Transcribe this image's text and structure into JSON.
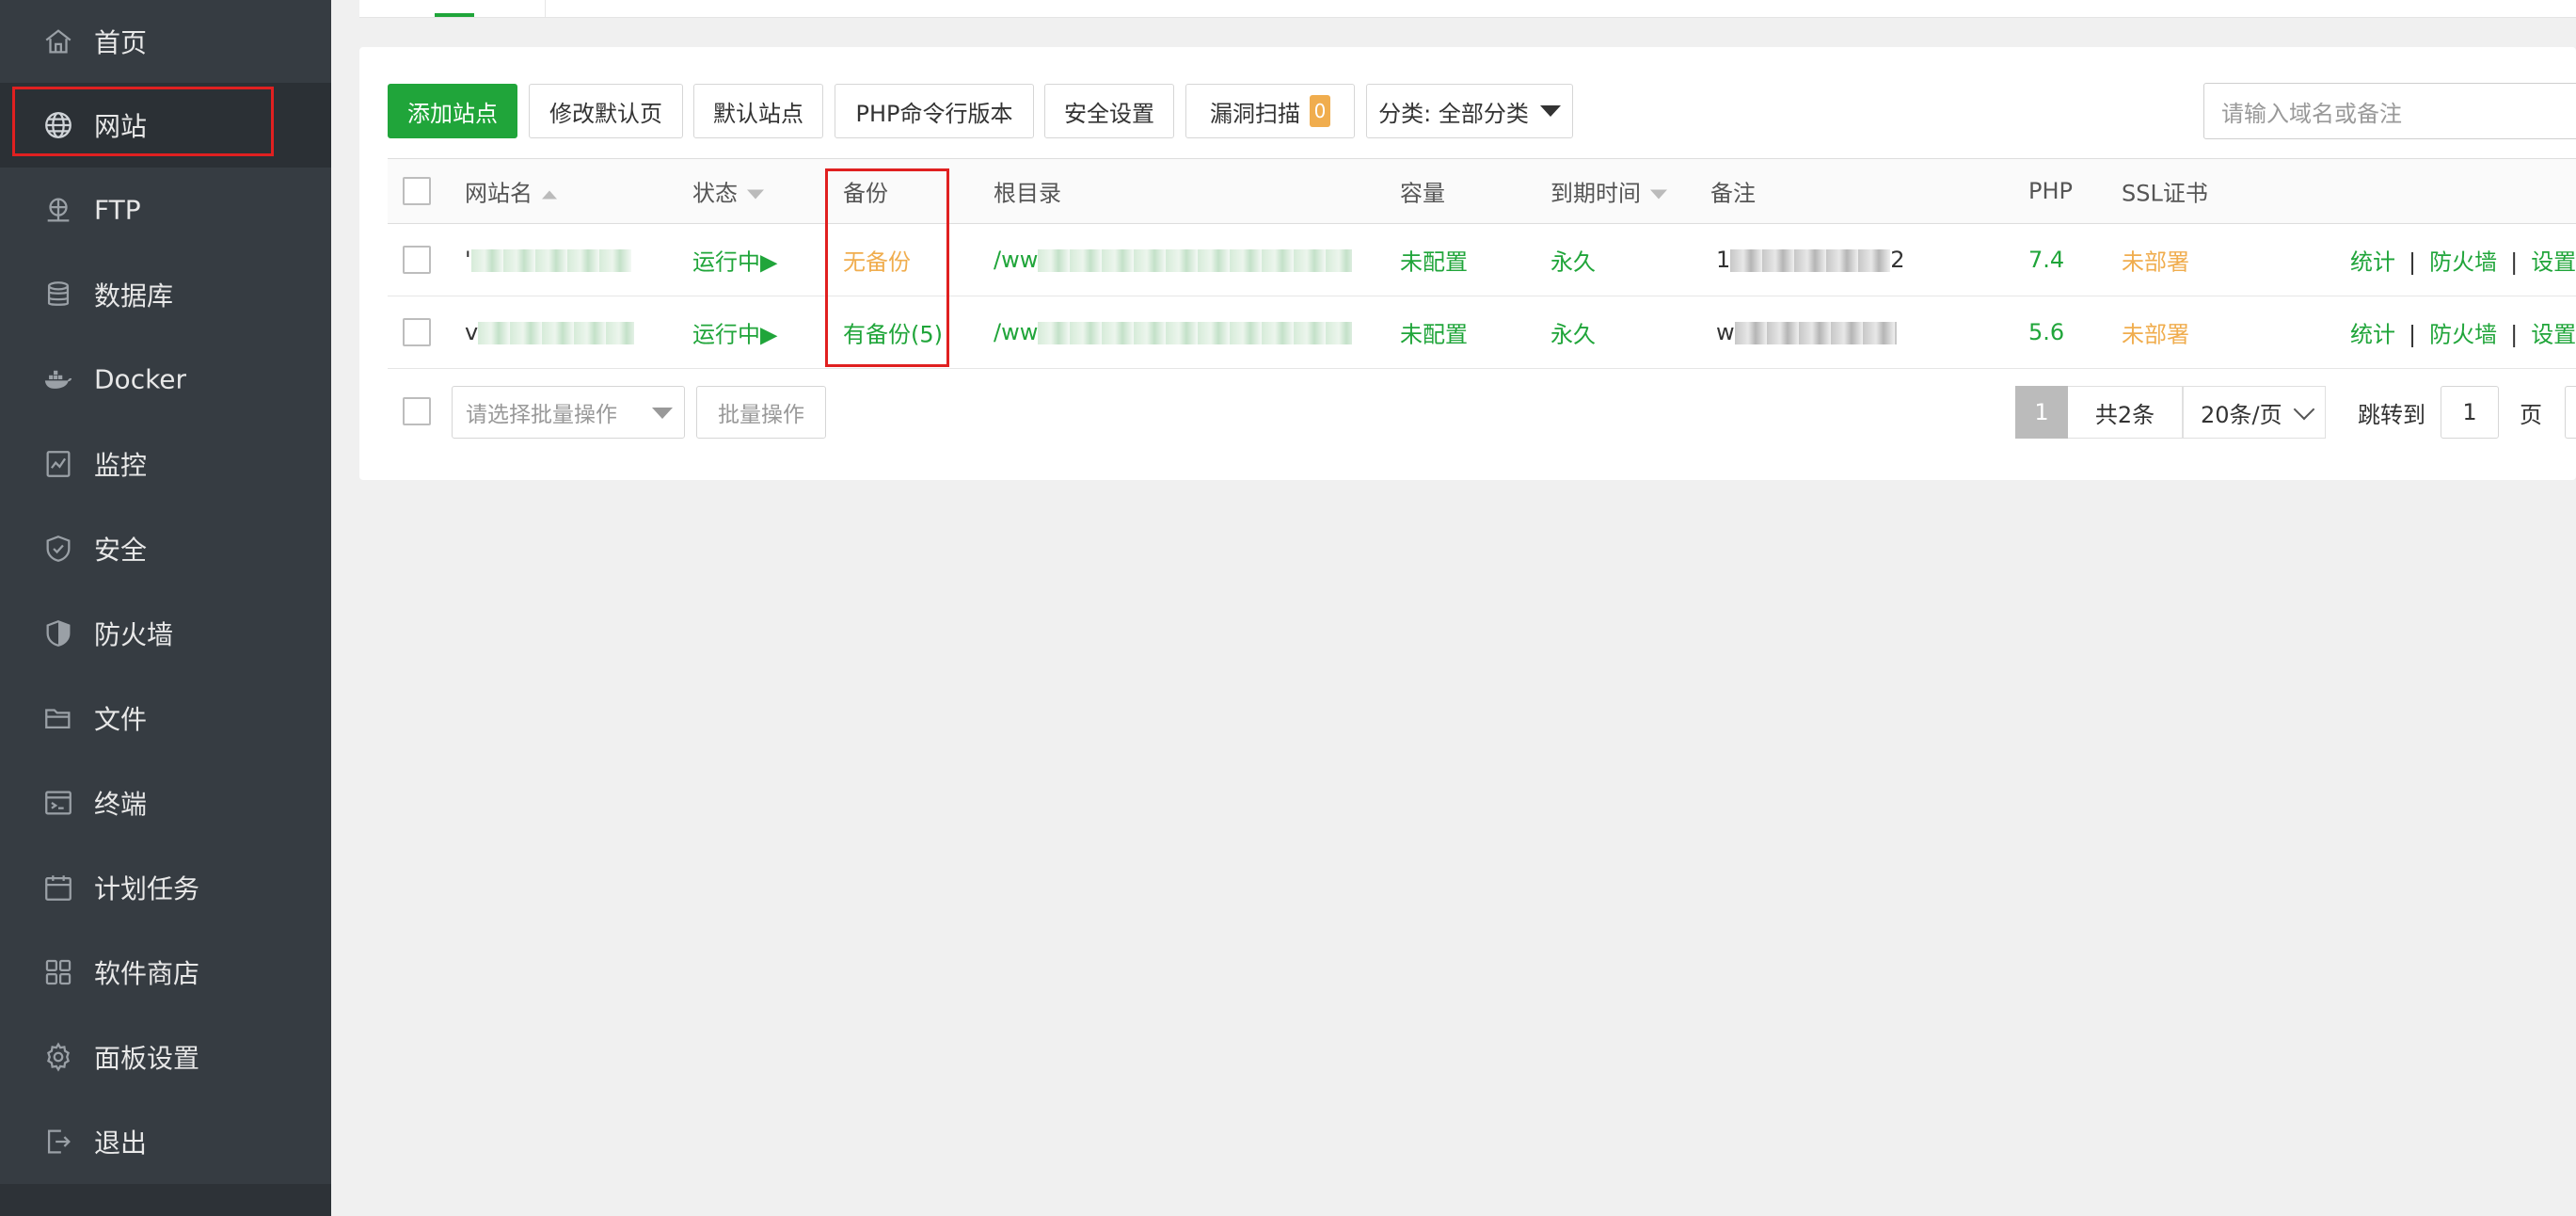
{
  "sidebar": {
    "items": [
      {
        "label": "首页",
        "icon": "home-icon"
      },
      {
        "label": "网站",
        "icon": "globe-icon",
        "active": true
      },
      {
        "label": "FTP",
        "icon": "ftp-icon"
      },
      {
        "label": "数据库",
        "icon": "database-icon"
      },
      {
        "label": "Docker",
        "icon": "docker-icon"
      },
      {
        "label": "监控",
        "icon": "monitor-icon"
      },
      {
        "label": "安全",
        "icon": "shield-check-icon"
      },
      {
        "label": "防火墙",
        "icon": "firewall-shield-icon"
      },
      {
        "label": "文件",
        "icon": "folder-icon"
      },
      {
        "label": "终端",
        "icon": "terminal-icon"
      },
      {
        "label": "计划任务",
        "icon": "calendar-icon"
      },
      {
        "label": "软件商店",
        "icon": "apps-grid-icon"
      },
      {
        "label": "面板设置",
        "icon": "gear-icon"
      },
      {
        "label": "退出",
        "icon": "logout-icon"
      }
    ]
  },
  "toolbar": {
    "add_site": "添加站点",
    "edit_default_page": "修改默认页",
    "default_site": "默认站点",
    "php_cli_version": "PHP命令行版本",
    "security_settings": "安全设置",
    "vuln_scan": "漏洞扫描",
    "vuln_count": "0",
    "category": "分类: 全部分类",
    "search_placeholder": "请输入域名或备注"
  },
  "table": {
    "headers": {
      "site_name": "网站名",
      "status": "状态",
      "backup": "备份",
      "root_dir": "根目录",
      "capacity": "容量",
      "expire": "到期时间",
      "note": "备注",
      "php": "PHP",
      "ssl": "SSL证书"
    },
    "rows": [
      {
        "site_name_prefix": "'",
        "status": "运行中▶",
        "backup": "无备份",
        "root_dir_prefix": "/ww",
        "capacity": "未配置",
        "expire": "永久",
        "note_prefix": "1",
        "note_suffix": "2",
        "php": "7.4",
        "ssl": "未部署",
        "actions": [
          "统计",
          "防火墙",
          "设置"
        ]
      },
      {
        "site_name_prefix": "v",
        "status": "运行中▶",
        "backup": "有备份(5)",
        "root_dir_prefix": "/ww",
        "capacity": "未配置",
        "expire": "永久",
        "note_prefix": "w",
        "note_suffix": "",
        "php": "5.6",
        "ssl": "未部署",
        "actions": [
          "统计",
          "防火墙",
          "设置"
        ]
      }
    ]
  },
  "footer": {
    "batch_placeholder": "请选择批量操作",
    "batch_button": "批量操作",
    "current_page": "1",
    "total": "共2条",
    "page_size": "20条/页",
    "jump_to": "跳转到",
    "jump_value": "1",
    "page_unit": "页"
  },
  "colors": {
    "sidebar_bg": "#363c42",
    "accent_green": "#20a53a",
    "warning_orange": "#f0ad4e",
    "highlight_red": "#e02020"
  }
}
